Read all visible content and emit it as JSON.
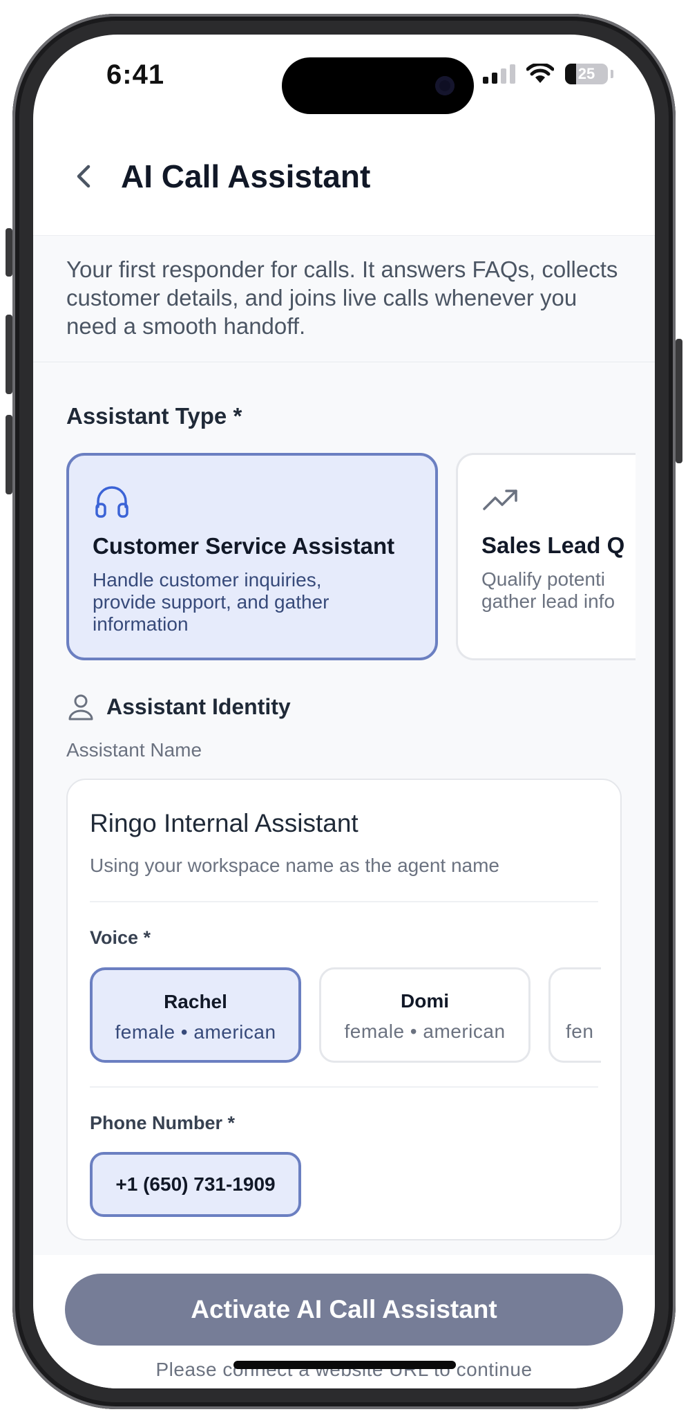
{
  "status_bar": {
    "time": "6:41",
    "battery": "25"
  },
  "header": {
    "title": "AI Call Assistant"
  },
  "description": "Your first responder for calls. It answers FAQs, collects customer details, and joins live calls whenever you need a smooth handoff.",
  "assistant_type": {
    "label": "Assistant Type *",
    "options": [
      {
        "title": "Customer Service Assistant",
        "description": "Handle customer inquiries, provide support, and gather information",
        "icon": "headphones-icon",
        "selected": true
      },
      {
        "title": "Sales Lead Q",
        "description_line1": "Qualify potenti",
        "description_line2": "gather lead info",
        "icon": "trending-up-icon",
        "selected": false
      }
    ]
  },
  "identity": {
    "section_title": "Assistant Identity",
    "name_label": "Assistant Name",
    "name_value": "Ringo Internal Assistant",
    "name_hint": "Using your workspace name as the agent name",
    "voice_label": "Voice *",
    "voices": [
      {
        "name": "Rachel",
        "detail": "female • american",
        "selected": true
      },
      {
        "name": "Domi",
        "detail": "female • american",
        "selected": false
      },
      {
        "name": "",
        "detail": "fen",
        "selected": false
      }
    ],
    "phone_label": "Phone Number *",
    "phone_value": "+1 (650) 731-1909"
  },
  "footer": {
    "activate_label": "Activate AI Call Assistant",
    "note": "Please connect a website URL to continue"
  },
  "colors": {
    "accent_border": "#6b7fc1",
    "accent_bg": "#e6ebfb",
    "button_disabled": "#767d97"
  }
}
